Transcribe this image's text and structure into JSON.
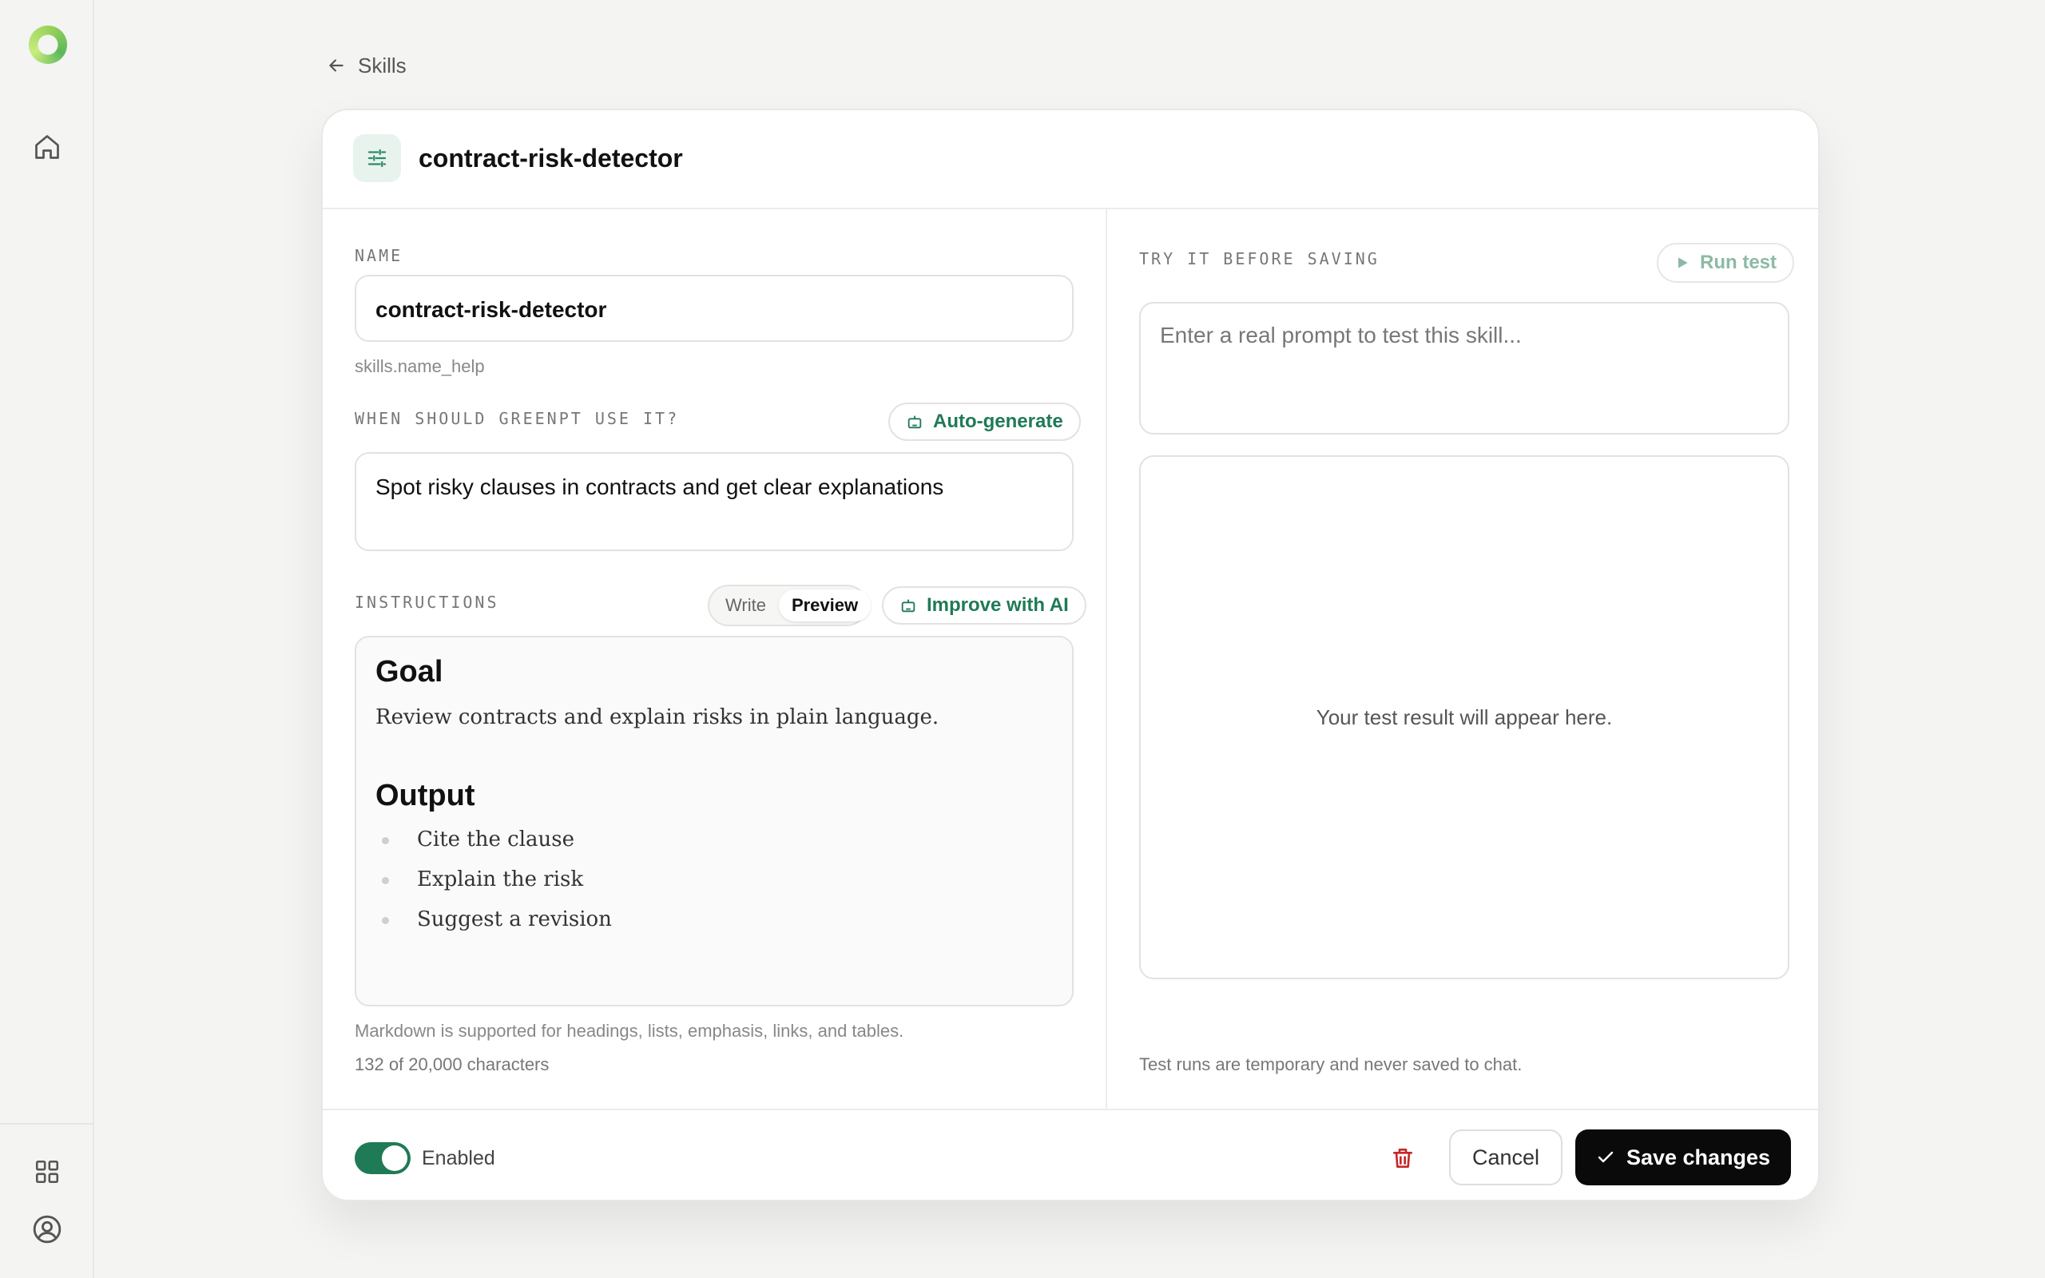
{
  "sidebar": {
    "icons": [
      "logo-icon",
      "home-icon",
      "grid-icon",
      "user-circle-icon"
    ]
  },
  "back": {
    "label": "Skills"
  },
  "header": {
    "title": "contract-risk-detector"
  },
  "name": {
    "label": "NAME",
    "value": "contract-risk-detector",
    "help": "skills.name_help"
  },
  "when": {
    "label": "WHEN SHOULD GREENPT USE IT?",
    "auto_label": "Auto-generate",
    "value": "Spot risky clauses in contracts and get clear explanations"
  },
  "instructions": {
    "label": "INSTRUCTIONS",
    "write_label": "Write",
    "preview_label": "Preview",
    "improve_label": "Improve with AI",
    "heading_goal": "Goal",
    "goal_text": "Review contracts and explain risks in plain language.",
    "heading_output": "Output",
    "bullets": [
      "Cite the clause",
      "Explain the risk",
      "Suggest a revision"
    ],
    "help": "Markdown is supported for headings, lists, emphasis, links, and tables.",
    "count": "132 of 20,000 characters"
  },
  "test": {
    "label": "TRY IT BEFORE SAVING",
    "run_label": "Run test",
    "placeholder": "Enter a real prompt to test this skill...",
    "result_placeholder": "Your test result will appear here.",
    "note": "Test runs are temporary and never saved to chat."
  },
  "footer": {
    "toggle_label": "Enabled",
    "toggle_on": true,
    "cancel_label": "Cancel",
    "save_label": "Save changes"
  },
  "colors": {
    "accent": "#1f7a56",
    "save_bg": "#0a0a0a",
    "danger": "#c62828"
  }
}
